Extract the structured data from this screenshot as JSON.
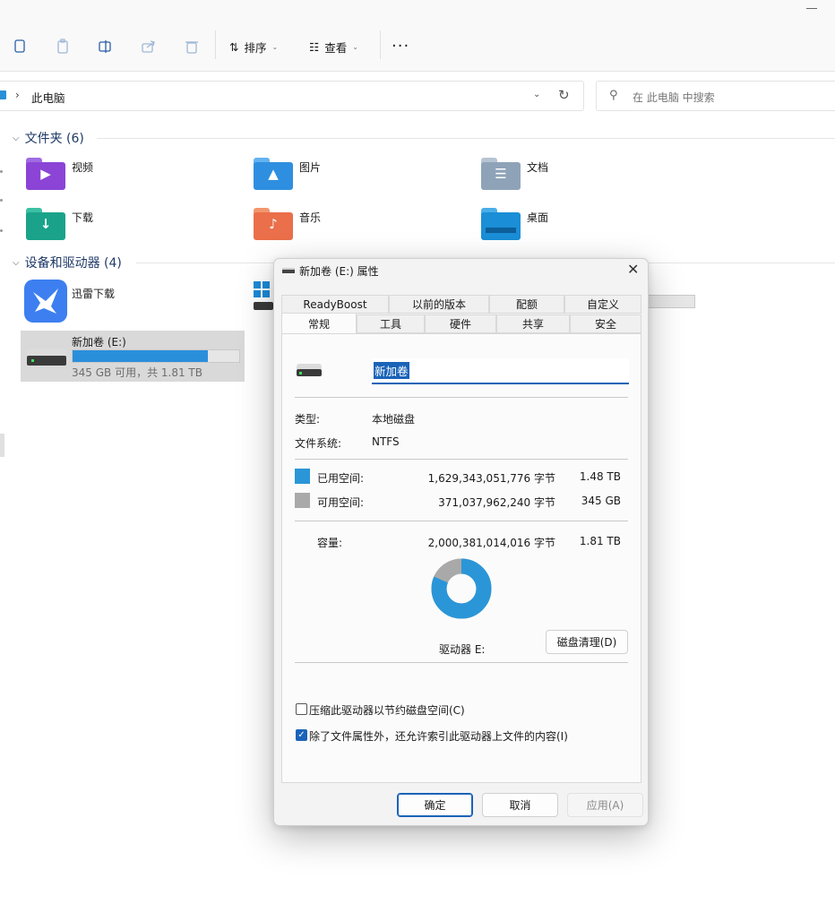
{
  "toolbar": {
    "sort_label": "排序",
    "view_label": "查看",
    "more_label": "···"
  },
  "address": {
    "separator": "›",
    "path": "此电脑",
    "search_placeholder": "在 此电脑 中搜索"
  },
  "folders_group": {
    "title": "文件夹 (6)",
    "items": [
      {
        "label": "视频",
        "color": "#8b44d6"
      },
      {
        "label": "图片",
        "color": "#2e8fe0"
      },
      {
        "label": "文档",
        "color": "#8fa3b8"
      },
      {
        "label": "下载",
        "color": "#1aa38a"
      },
      {
        "label": "音乐",
        "color": "#ea6f4a"
      },
      {
        "label": "桌面",
        "color": "#1a8ed6"
      }
    ]
  },
  "devices_group": {
    "title": "设备和驱动器 (4)",
    "items": [
      {
        "label": "迅雷下载"
      },
      {
        "label": "新加卷 (E:)",
        "detail": "345 GB 可用，共 1.81 TB",
        "used_fraction": 0.81
      }
    ]
  },
  "dialog": {
    "title": "新加卷 (E:) 属性",
    "close_glyph": "✕",
    "tabs_row1": [
      "ReadyBoost",
      "以前的版本",
      "配额",
      "自定义"
    ],
    "tabs_row2": [
      "常规",
      "工具",
      "硬件",
      "共享",
      "安全"
    ],
    "active_tab": "常规",
    "volume_name": "新加卷",
    "type_label": "类型:",
    "type_value": "本地磁盘",
    "fs_label": "文件系统:",
    "fs_value": "NTFS",
    "used_label": "已用空间:",
    "used_bytes": "1,629,343,051,776 字节",
    "used_size": "1.48 TB",
    "free_label": "可用空间:",
    "free_bytes": "371,037,962,240 字节",
    "free_size": "345 GB",
    "cap_label": "容量:",
    "cap_bytes": "2,000,381,014,016 字节",
    "cap_size": "1.81 TB",
    "used_color": "#2a96d8",
    "free_color": "#a9a9a9",
    "used_fraction": 0.8145,
    "drive_label": "驱动器 E:",
    "cleanup_button": "磁盘清理(D)",
    "compress_label": "压缩此驱动器以节约磁盘空间(C)",
    "compress_checked": false,
    "index_label": "除了文件属性外，还允许索引此驱动器上文件的内容(I)",
    "index_checked": true,
    "ok_button": "确定",
    "cancel_button": "取消",
    "apply_button": "应用(A)"
  }
}
